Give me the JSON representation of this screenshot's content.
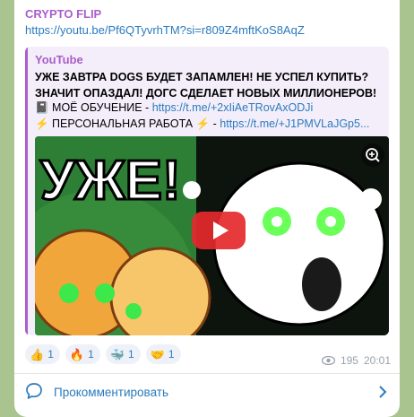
{
  "post": {
    "channel_name": "CRYPTO FLIP",
    "link": "https://youtu.be/Pf6QTyvrhTM?si=r809Z4mftKoS8AqZ",
    "preview": {
      "site": "YouTube",
      "title": "УЖЕ ЗАВТРА DOGS БУДЕТ ЗАПАМЛЕН! НЕ УСПЕЛ КУПИТЬ? ЗНАЧИТ ОПАЗДАЛ! ДОГС СДЕЛАЕТ НОВЫХ МИЛЛИОНЕРОВ!",
      "line1_prefix": "📓 МОЁ ОБУЧЕНИЕ - ",
      "line1_link": "https://t.me/+2xIiAeTRovAxODJi",
      "line2_prefix": "⚡ ПЕРСОНАЛЬНАЯ РАБОТА ⚡ - ",
      "line2_link": "https://t.me/+J1PMVLaJGp5...",
      "thumbnail_text": "УЖЕ!"
    },
    "reactions": [
      {
        "emoji": "👍",
        "count": "1"
      },
      {
        "emoji": "🔥",
        "count": "1"
      },
      {
        "emoji": "🐳",
        "count": "1"
      },
      {
        "emoji": "🤝",
        "count": "1"
      }
    ],
    "views": "195",
    "time": "20:01",
    "comment_label": "Прокомментировать"
  },
  "colors": {
    "accent": "#a95ec9",
    "link": "#2a7bbd",
    "background": "#a9c48f"
  }
}
